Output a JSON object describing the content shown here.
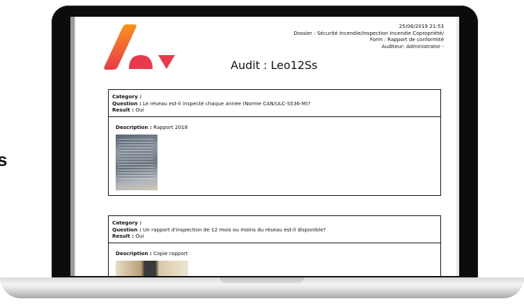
{
  "side_fragment": "s",
  "document": {
    "meta_lines": [
      "25/06/2019 21:53",
      "Dossier : Sécurité Incendie/Inspection Incendie Copropriété/",
      "Form : Rapport de conformité",
      "Auditeur: Administrator -"
    ],
    "title": "Audit : Leo12Ss",
    "cards": [
      {
        "category_label": "Category :",
        "category_value": "",
        "question_label": "Question :",
        "question_value": "Le réseau est-il inspecté chaque année (Norme CAN/ULC-S536-M)?",
        "result_label": "Result :",
        "result_value": "Oui",
        "description_label": "Description :",
        "description_value": "Rapport 2018"
      },
      {
        "category_label": "Category :",
        "category_value": "",
        "question_label": "Question :",
        "question_value": "Un rapport d'inspection de 12 mois ou moins du réseau est-il disponible?",
        "result_label": "Result :",
        "result_value": "Oui",
        "description_label": "Description :",
        "description_value": "Copie rapport"
      }
    ]
  },
  "colors": {
    "logo_orange": "#f7931e",
    "logo_red": "#e83a4b",
    "bezel": "#0c0c0c"
  }
}
